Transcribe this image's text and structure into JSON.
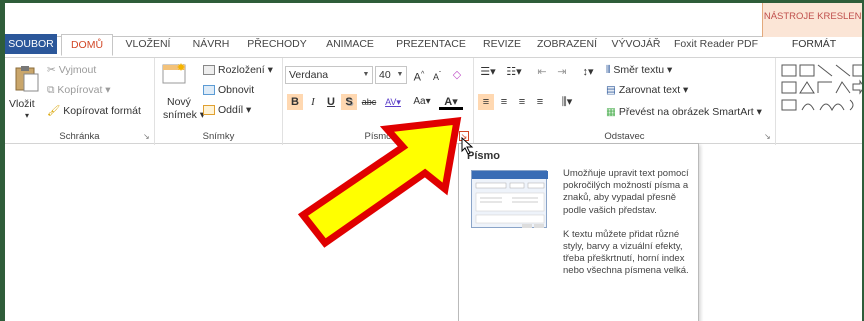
{
  "contextual": {
    "title": "NÁSTROJE KRESLENÍ"
  },
  "tabs": [
    {
      "label": "SOUBOR"
    },
    {
      "label": "DOMŮ"
    },
    {
      "label": "VLOŽENÍ"
    },
    {
      "label": "NÁVRH"
    },
    {
      "label": "PŘECHODY"
    },
    {
      "label": "ANIMACE"
    },
    {
      "label": "PREZENTACE"
    },
    {
      "label": "REVIZE"
    },
    {
      "label": "ZOBRAZENÍ"
    },
    {
      "label": "VÝVOJÁŘ"
    },
    {
      "label": "Foxit Reader PDF"
    },
    {
      "label": "FORMÁT"
    }
  ],
  "groups": {
    "clipboard": {
      "label": "Schránka",
      "paste": "Vložit",
      "cut": "Vyjmout",
      "copy": "Kopírovat",
      "format_painter": "Kopírovat formát"
    },
    "slides": {
      "label": "Snímky",
      "new_slide_1": "Nový",
      "new_slide_2": "snímek",
      "layout": "Rozložení",
      "reset": "Obnovit",
      "section": "Oddíl"
    },
    "font": {
      "label": "Písmo",
      "font_name": "Verdana",
      "font_size": "40",
      "bold": "B",
      "italic": "I",
      "underline": "U",
      "shadow": "S",
      "strike": "abc",
      "spacing": "AV",
      "case": "Aa",
      "font_color": "A"
    },
    "paragraph": {
      "label": "Odstavec",
      "text_direction": "Směr textu",
      "align_text": "Zarovnat text",
      "smartart": "Převést na obrázek SmartArt"
    }
  },
  "tooltip": {
    "title": "Písmo",
    "para1": "Umožňuje upravit text pomocí pokročilých možností písma a znaků, aby vypadal přesně podle vašich představ.",
    "para2": "K textu můžete přidat různé styly, barvy a vizuální efekty, třeba přeškrtnutí, horní index nebo všechna písmena velká."
  },
  "colors": {
    "accent": "#d24726",
    "file_tab": "#2b579a",
    "arrow_fill": "#ffff00",
    "arrow_stroke": "#e00000"
  }
}
